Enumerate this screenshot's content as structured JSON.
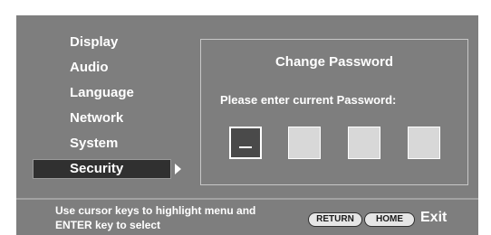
{
  "menu": {
    "items": [
      {
        "label": "Display"
      },
      {
        "label": "Audio"
      },
      {
        "label": "Language"
      },
      {
        "label": "Network"
      },
      {
        "label": "System"
      },
      {
        "label": "Security",
        "selected": true
      }
    ]
  },
  "panel": {
    "title": "Change Password",
    "prompt": "Please enter current Password:",
    "password_boxes": 4,
    "active_box": 1
  },
  "footer": {
    "hint_line1": "Use cursor keys to highlight menu and",
    "hint_line2": "ENTER key to select",
    "return_label": "RETURN",
    "home_label": "HOME",
    "exit_label": "Exit"
  },
  "colors": {
    "background": "#7e7e7e",
    "selected_item": "#303030",
    "text": "#ffffff",
    "pill": "#e6e6e6"
  }
}
